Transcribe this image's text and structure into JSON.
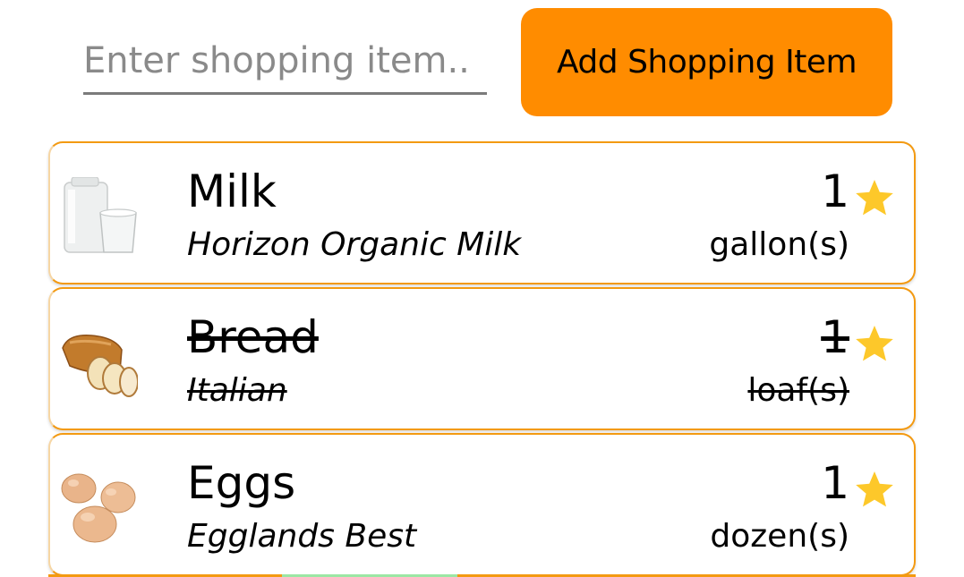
{
  "toolbar": {
    "search_placeholder": "Enter shopping item..",
    "search_value": "",
    "add_label": "Add Shopping Item"
  },
  "colors": {
    "accent": "#ff8c00",
    "card_border": "#f39a12",
    "star": "#fdc82a"
  },
  "items": [
    {
      "name": "Milk",
      "brand": "Horizon Organic Milk",
      "quantity": "1",
      "unit": "gallon(s)",
      "purchased": false,
      "favorite": true,
      "icon": "milk-icon"
    },
    {
      "name": "Bread",
      "brand": "Italian",
      "quantity": "1",
      "unit": "loaf(s)",
      "purchased": true,
      "favorite": true,
      "icon": "bread-icon"
    },
    {
      "name": "Eggs",
      "brand": "Egglands Best",
      "quantity": "1",
      "unit": "dozen(s)",
      "purchased": false,
      "favorite": true,
      "icon": "eggs-icon"
    }
  ]
}
